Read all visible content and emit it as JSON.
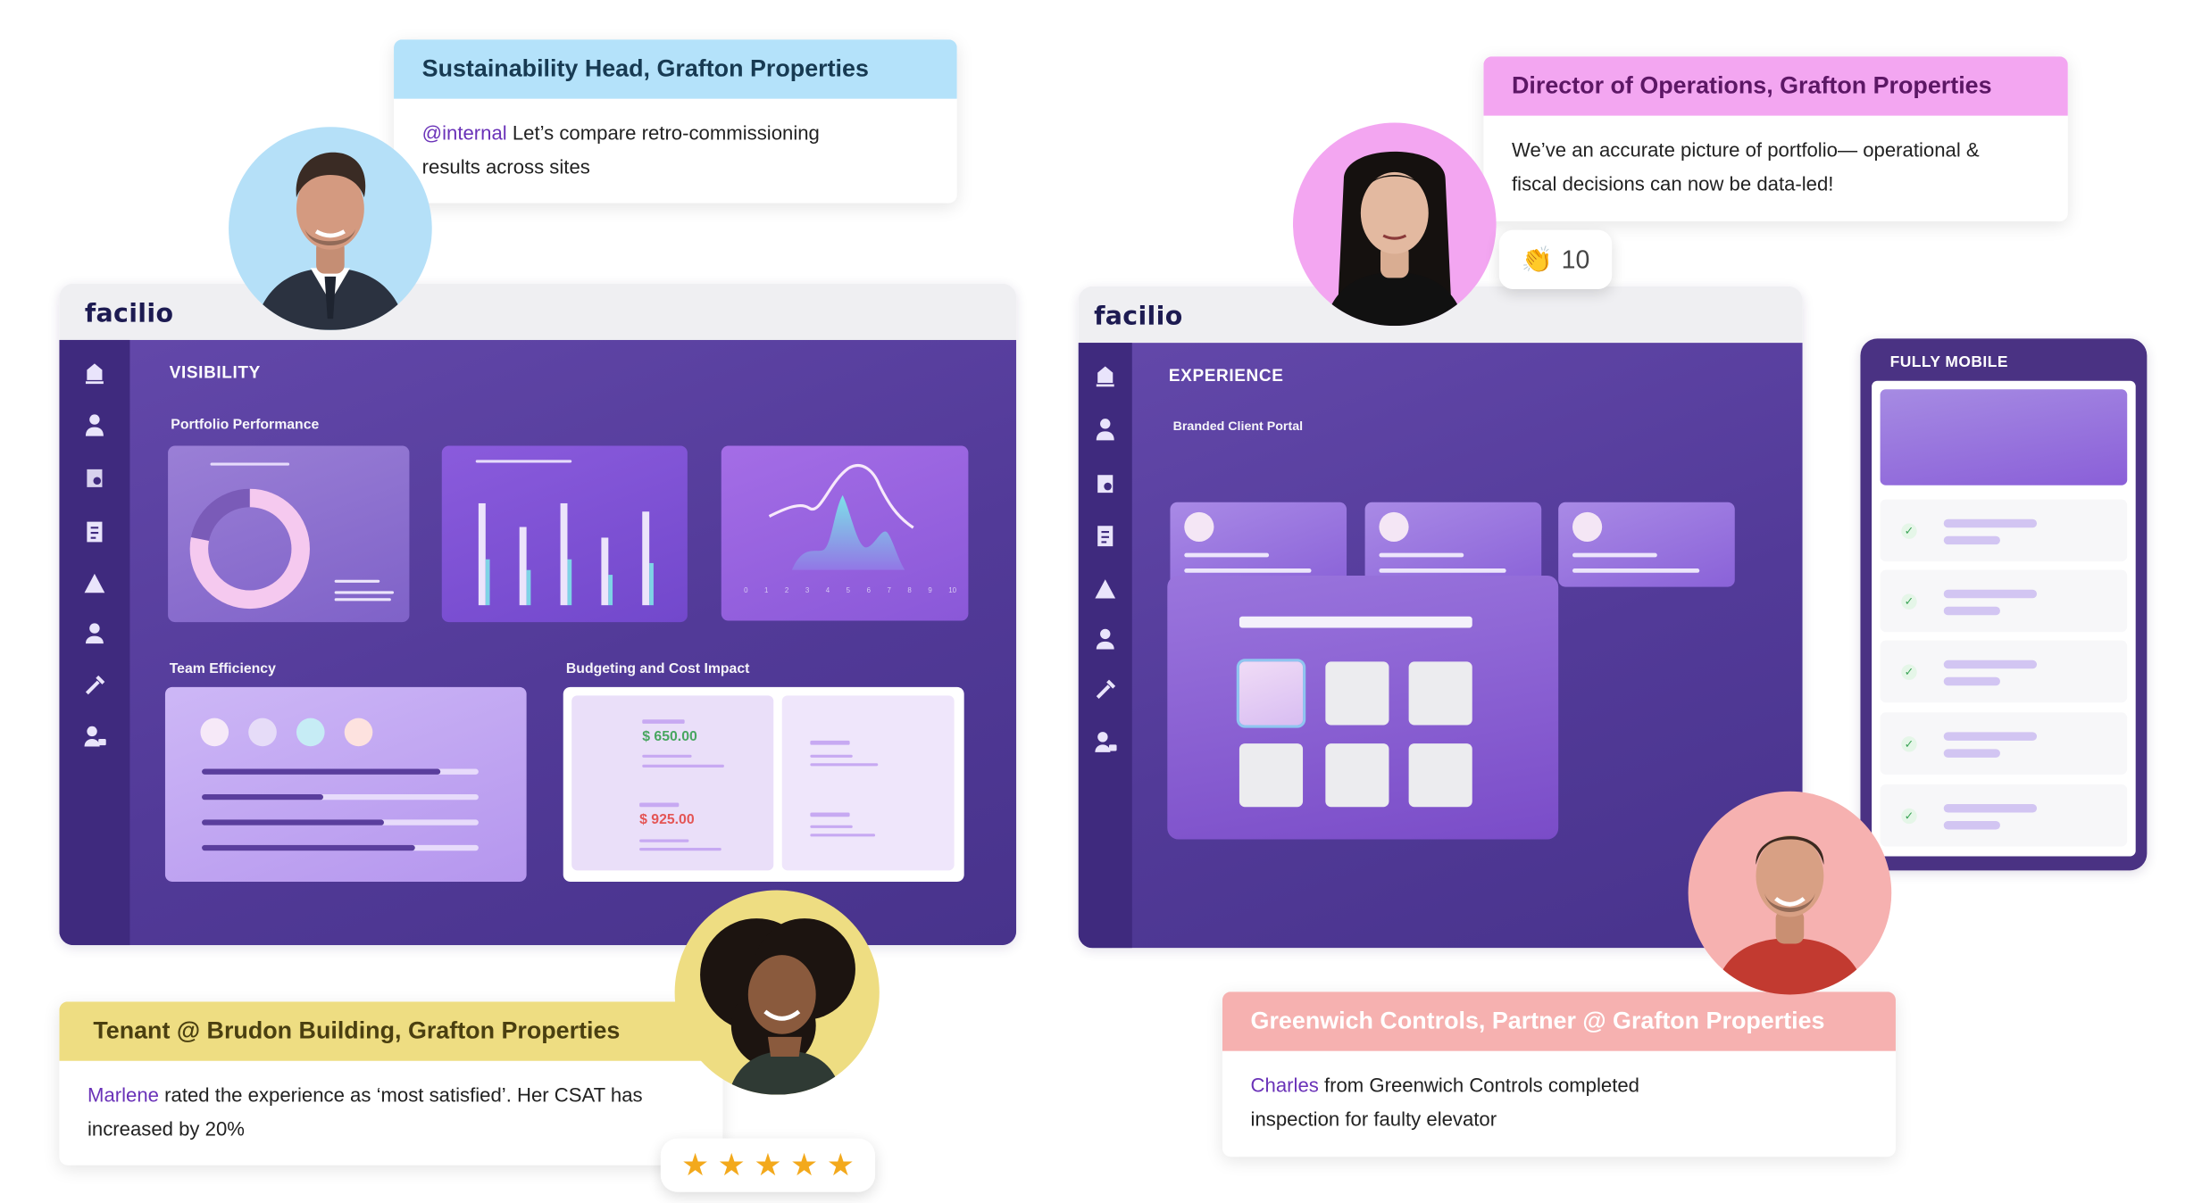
{
  "brand": {
    "logo": "facilio"
  },
  "visibility": {
    "section_title": "VISIBILITY",
    "portfolio_label": "Portfolio Performance",
    "team_label": "Team Efficiency",
    "budget_label": "Budgeting and Cost Impact",
    "budget_value_1": "$ 650.00",
    "budget_value_2": "$ 925.00",
    "team_progress": [
      0.86,
      0.44,
      0.66,
      0.77
    ],
    "donut_fraction": 0.78,
    "bar_heights": [
      0.86,
      0.66,
      0.86,
      0.57,
      0.79
    ],
    "area_axis_ticks": [
      "0",
      "1",
      "2",
      "3",
      "4",
      "5",
      "6",
      "7",
      "8",
      "9",
      "10"
    ],
    "team_dot_colors": [
      "#f6e9f8",
      "#e6dcf8",
      "#c6ecf5",
      "#fde2df"
    ]
  },
  "experience": {
    "section_title": "EXPERIENCE",
    "portal_label": "Branded Client Portal"
  },
  "mobile": {
    "title": "FULLY MOBILE"
  },
  "testimonials": {
    "sustainability": {
      "heading": "Sustainability Head, Grafton Properties",
      "mention": "@internal",
      "text": "Let’s compare retro-commissioning results across sites"
    },
    "director": {
      "heading": "Director of Operations, Grafton Properties",
      "text": "We’ve an accurate picture of portfolio— operational & fiscal decisions can now be data-led!",
      "reaction_count": "10"
    },
    "tenant": {
      "heading": "Tenant @ Brudon Building, Grafton Properties",
      "name": "Marlene",
      "text": "rated the experience as ‘most satisfied’. Her CSAT has increased by 20%",
      "rating": 5
    },
    "partner": {
      "heading": "Greenwich Controls, Partner @ Grafton Properties",
      "name": "Charles",
      "text": "from Greenwich Controls completed inspection for faulty elevator"
    }
  },
  "colors": {
    "sustainability_header": "#b4e2fa",
    "director_header": "#f3a6f1",
    "tenant_header": "#eedd82",
    "partner_header": "#f6b1b0",
    "app_purple": "#523a98",
    "rail_purple": "#3f2a7e",
    "mention_purple": "#6a32b8"
  },
  "icons": [
    "building-icon",
    "technician-icon",
    "inspection-icon",
    "checklist-icon",
    "asset-icon",
    "user-icon",
    "tools-icon",
    "visitor-icon",
    "clap-icon",
    "star-icon"
  ]
}
